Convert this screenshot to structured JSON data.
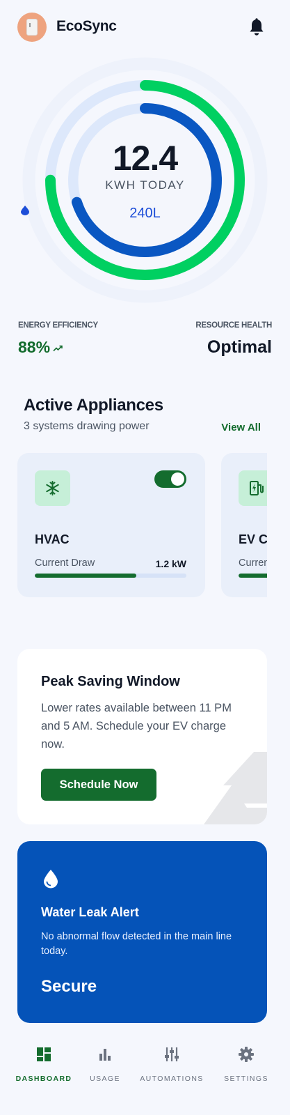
{
  "header": {
    "app_title": "EcoSync"
  },
  "summary": {
    "energy_value": "12.4",
    "energy_unit": "KWH TODAY",
    "water_value": "240L",
    "energy_ring_progress": 0.75,
    "water_ring_progress": 0.7
  },
  "stats": {
    "efficiency_label": "ENERGY EFFICIENCY",
    "efficiency_value": "88%",
    "health_label": "RESOURCE HEALTH",
    "health_value": "Optimal"
  },
  "appliances": {
    "title": "Active Appliances",
    "subtitle": "3 systems drawing power",
    "view_all": "View All",
    "items": [
      {
        "name": "HVAC",
        "draw_label": "Current Draw",
        "draw_value": "1.2 kW",
        "load_fraction": 0.67,
        "enabled": true,
        "icon": "snowflake-icon"
      },
      {
        "name": "EV C",
        "draw_label": "Curren",
        "draw_value": "",
        "load_fraction": 0.6,
        "enabled": true,
        "icon": "ev-charger-icon"
      }
    ]
  },
  "peak": {
    "title": "Peak Saving Window",
    "text": "Lower rates available between 11 PM and 5 AM. Schedule your EV charge now.",
    "button_label": "Schedule Now"
  },
  "leak": {
    "title": "Water Leak Alert",
    "text": "No abnormal flow detected in the main line today.",
    "status": "Secure"
  },
  "nav": {
    "items": [
      {
        "label": "DASHBOARD",
        "icon": "dashboard-icon",
        "active": true
      },
      {
        "label": "USAGE",
        "icon": "bar-chart-icon",
        "active": false
      },
      {
        "label": "AUTOMATIONS",
        "icon": "sliders-icon",
        "active": false
      },
      {
        "label": "SETTINGS",
        "icon": "gear-icon",
        "active": false
      }
    ]
  },
  "colors": {
    "brand_green": "#146c2e",
    "ring_green": "#00d061",
    "ring_blue": "#0a57c2",
    "ring_track": "#dde8fb",
    "leak_card": "#0553b8"
  }
}
